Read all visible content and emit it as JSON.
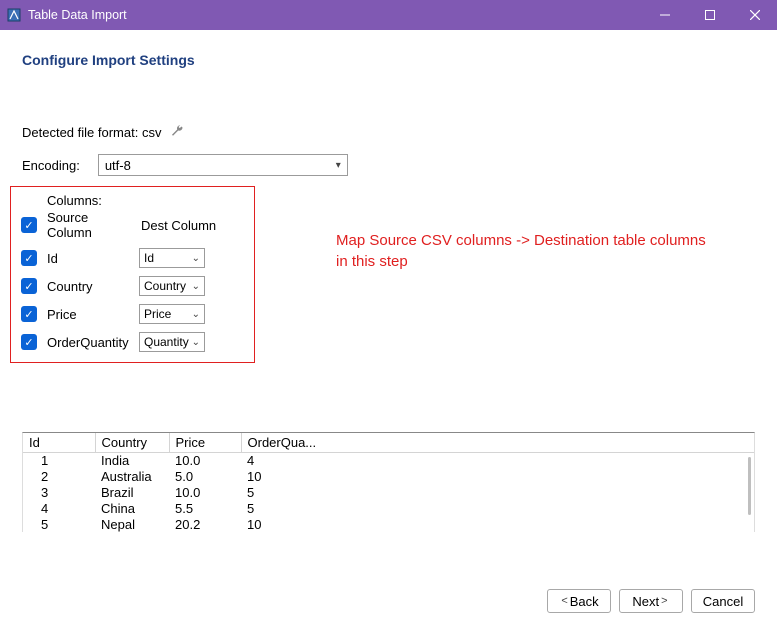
{
  "window": {
    "title": "Table Data Import"
  },
  "heading": "Configure Import Settings",
  "detected": {
    "label": "Detected file format: csv"
  },
  "encoding": {
    "label": "Encoding:",
    "value": "utf-8"
  },
  "columns": {
    "section_label": "Columns:",
    "source_header": "Source Column",
    "dest_header": "Dest Column",
    "rows": [
      {
        "source": "Id",
        "dest": "Id"
      },
      {
        "source": "Country",
        "dest": "Country"
      },
      {
        "source": "Price",
        "dest": "Price"
      },
      {
        "source": "OrderQuantity",
        "dest": "Quantity"
      }
    ]
  },
  "annotation": {
    "line1": "Map Source CSV columns -> Destination table columns",
    "line2": "in this step"
  },
  "preview": {
    "headers": [
      "Id",
      "Country",
      "Price",
      "OrderQua..."
    ],
    "rows": [
      {
        "id": "1",
        "country": "India",
        "price": "10.0",
        "qty": "4"
      },
      {
        "id": "2",
        "country": "Australia",
        "price": "5.0",
        "qty": "10"
      },
      {
        "id": "3",
        "country": "Brazil",
        "price": "10.0",
        "qty": "5"
      },
      {
        "id": "4",
        "country": "China",
        "price": "5.5",
        "qty": "5"
      },
      {
        "id": "5",
        "country": "Nepal",
        "price": "20.2",
        "qty": "10"
      }
    ]
  },
  "buttons": {
    "back": "Back",
    "next": "Next",
    "cancel": "Cancel"
  }
}
